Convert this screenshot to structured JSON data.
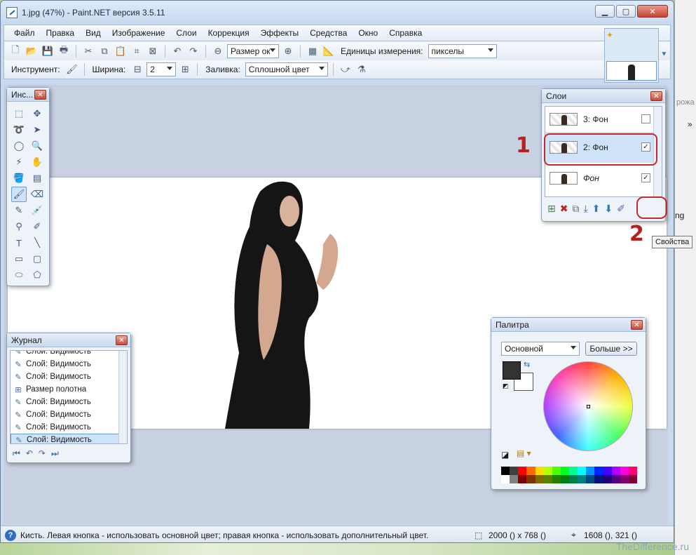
{
  "window": {
    "title": "1.jpg (47%) - Paint.NET версия 3.5.11"
  },
  "menu": [
    "Файл",
    "Правка",
    "Вид",
    "Изображение",
    "Слои",
    "Коррекция",
    "Эффекты",
    "Средства",
    "Окно",
    "Справка"
  ],
  "toolbar1": {
    "zoom_value": "Размер ок",
    "units_label": "Единицы измерения:",
    "units_value": "пикселы"
  },
  "toolbar2": {
    "tool_label": "Инструмент:",
    "width_label": "Ширина:",
    "width_value": "2",
    "fill_label": "Заливка:",
    "fill_value": "Сплошной цвет"
  },
  "tools_panel": {
    "title": "Инс..."
  },
  "history_panel": {
    "title": "Журнал",
    "items": [
      "Слой: Видимость",
      "Слой: Видимость",
      "Слой: Видимость",
      "Размер полотна",
      "Слой: Видимость",
      "Слой: Видимость",
      "Слой: Видимость",
      "Слой: Видимость"
    ]
  },
  "layers_panel": {
    "title": "Слои",
    "layers": [
      {
        "name": "3: Фон",
        "visible": false
      },
      {
        "name": "2: Фон",
        "visible": true
      },
      {
        "name": "Фон",
        "visible": true
      }
    ]
  },
  "annotations": {
    "num1": "1",
    "num2": "2",
    "tooltip": "Свойства"
  },
  "palette_panel": {
    "title": "Палитра",
    "mode": "Основной",
    "more_button": "Больше >>",
    "primary_color": "#333333",
    "secondary_color": "#ffffff"
  },
  "status": {
    "help_text": "Кисть. Левая кнопка - использовать основной цвет; правая кнопка - использовать дополнительный цвет.",
    "image_size": "2000 () x 768 ()",
    "cursor_pos": "1608 (), 321 ()"
  },
  "watermark": "TheDifference.ru",
  "side": {
    "text1": "рожа",
    "text2": "»",
    "text3": "ng"
  }
}
